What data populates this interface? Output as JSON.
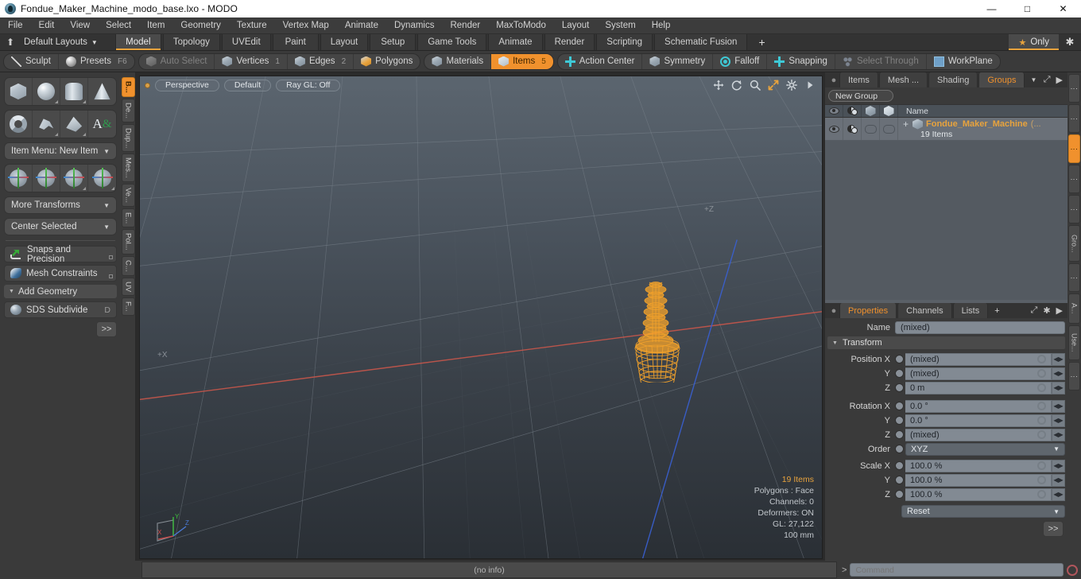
{
  "window": {
    "title": "Fondue_Maker_Machine_modo_base.lxo - MODO",
    "minimize": "—",
    "maximize": "□",
    "close": "✕"
  },
  "menubar": [
    "File",
    "Edit",
    "View",
    "Select",
    "Item",
    "Geometry",
    "Texture",
    "Vertex Map",
    "Animate",
    "Dynamics",
    "Render",
    "MaxToModo",
    "Layout",
    "System",
    "Help"
  ],
  "layoutbar": {
    "layouts_label": "Default Layouts",
    "tabs": [
      "Model",
      "Topology",
      "UVEdit",
      "Paint",
      "Layout",
      "Setup",
      "Game Tools",
      "Animate",
      "Render",
      "Scripting",
      "Schematic Fusion"
    ],
    "active_tab": "Model",
    "add_label": "+",
    "only_label": "Only"
  },
  "modebar": {
    "left_group": [
      {
        "label": "Sculpt",
        "icon": "pen-icon",
        "state": "normal",
        "num": ""
      },
      {
        "label": "Presets",
        "icon": "sphere-icon",
        "state": "normal",
        "num": "F6"
      }
    ],
    "select_group": [
      {
        "label": "Auto Select",
        "icon": "cube-icon",
        "state": "dim",
        "num": ""
      },
      {
        "label": "Vertices",
        "icon": "cube-icon",
        "state": "normal",
        "num": "1"
      },
      {
        "label": "Edges",
        "icon": "cube-icon",
        "state": "normal",
        "num": "2"
      },
      {
        "label": "Polygons",
        "icon": "cube-icon",
        "state": "normal",
        "num": ""
      },
      {
        "label": "Materials",
        "icon": "cube-icon",
        "state": "normal",
        "num": ""
      },
      {
        "label": "Items",
        "icon": "cube-icon",
        "state": "active",
        "num": "5"
      }
    ],
    "right_group": [
      {
        "label": "Action Center",
        "icon": "crosshair-icon",
        "state": "normal",
        "num": ""
      },
      {
        "label": "Symmetry",
        "icon": "cube-icon",
        "state": "normal",
        "num": ""
      },
      {
        "label": "Falloff",
        "icon": "target-icon",
        "state": "normal",
        "num": ""
      },
      {
        "label": "Snapping",
        "icon": "plus-icon",
        "state": "normal",
        "num": ""
      },
      {
        "label": "Select Through",
        "icon": "dots-icon",
        "state": "dim",
        "num": ""
      },
      {
        "label": "WorkPlane",
        "icon": "workplane-icon",
        "state": "normal",
        "num": ""
      }
    ]
  },
  "left_toolbox": {
    "primitives": [
      "cube-shape",
      "sphere-shape",
      "cylinder-shape",
      "cone-shape"
    ],
    "primitives2": [
      "torus-shape",
      "curve-shape",
      "polygon-shape",
      "text-shape"
    ],
    "item_menu": "Item Menu: New Item",
    "transforms": [
      "move-gizmo",
      "axis-gizmo",
      "rotate-gizmo",
      "scale-gizmo"
    ],
    "more_transforms": "More Transforms",
    "center_selected": "Center Selected",
    "snaps": "Snaps and Precision",
    "mesh_constraints": "Mesh Constraints",
    "add_geometry": "Add Geometry",
    "sds_subdivide": "SDS Subdivide",
    "sds_hotkey": "D",
    "goto": ">>",
    "vtabs": [
      "B...",
      "De...",
      "Dup...",
      "Mes...",
      "Ve...",
      "E...",
      "Pol...",
      "C...",
      "UV",
      "F..."
    ],
    "vtab_active": "B..."
  },
  "viewport": {
    "view_mode": "Perspective",
    "shading": "Default",
    "raygl": "Ray GL: Off",
    "axis_label_x": "+X",
    "axis_label_z": "+Z",
    "gizmo_axes": [
      "X",
      "Y",
      "Z"
    ],
    "stats": {
      "items": "19 Items",
      "polygons": "Polygons : Face",
      "channels": "Channels: 0",
      "deformers": "Deformers: ON",
      "gl": "GL: 27,122",
      "scale": "100 mm"
    },
    "icons": [
      "move-icon",
      "rotate-icon",
      "zoom-icon",
      "fit-icon",
      "gear-icon",
      "play-icon"
    ],
    "model_name": "fondue-maker-wireframe"
  },
  "groups_panel": {
    "tabs": [
      "Items",
      "Mesh ...",
      "Shading",
      "Groups"
    ],
    "active_tab": "Groups",
    "add_label": "+",
    "new_group_button": "New Group",
    "columns": [
      "visibility-col",
      "material-col",
      "lock-col",
      "render-col",
      "Name"
    ],
    "name_header": "Name",
    "rows": [
      {
        "expand": "+",
        "name": "Fondue_Maker_Machine",
        "suffix": "(...",
        "sub": "19 Items"
      }
    ]
  },
  "properties_panel": {
    "tabs": [
      "Properties",
      "Channels",
      "Lists"
    ],
    "active_tab": "Properties",
    "add_label": "+",
    "name_label": "Name",
    "name_value": "(mixed)",
    "transform_header": "Transform",
    "fields": [
      {
        "label": "Position X",
        "value": "(mixed)"
      },
      {
        "label": "Y",
        "value": "(mixed)"
      },
      {
        "label": "Z",
        "value": "0 m"
      },
      {
        "label": "Rotation X",
        "value": "0.0 °"
      },
      {
        "label": "Y",
        "value": "0.0 °"
      },
      {
        "label": "Z",
        "value": "(mixed)"
      }
    ],
    "order_label": "Order",
    "order_value": "XYZ",
    "scale_fields": [
      {
        "label": "Scale X",
        "value": "100.0 %"
      },
      {
        "label": "Y",
        "value": "100.0 %"
      },
      {
        "label": "Z",
        "value": "100.0 %"
      }
    ],
    "reset_label": "Reset",
    "goto": ">>",
    "rtabs": [
      "⋮",
      "⋮",
      "⋮",
      "⋮",
      "⋮",
      "Gro...",
      "⋮",
      "A...",
      "Use...",
      "⋮"
    ],
    "rtab_active_index": 2
  },
  "statusbar": {
    "info": "(no info)",
    "command_prompt": ">",
    "command_placeholder": "Command"
  },
  "colors": {
    "accent": "#f0912d",
    "accent_text": "#e8a33d",
    "panel_bg": "#3a3a3a",
    "list_bg": "#6a7078",
    "field_bg": "#828a93",
    "axis_x": "#c4564b",
    "axis_z": "#3a5fd0",
    "model_wire": "#f5a32a"
  }
}
